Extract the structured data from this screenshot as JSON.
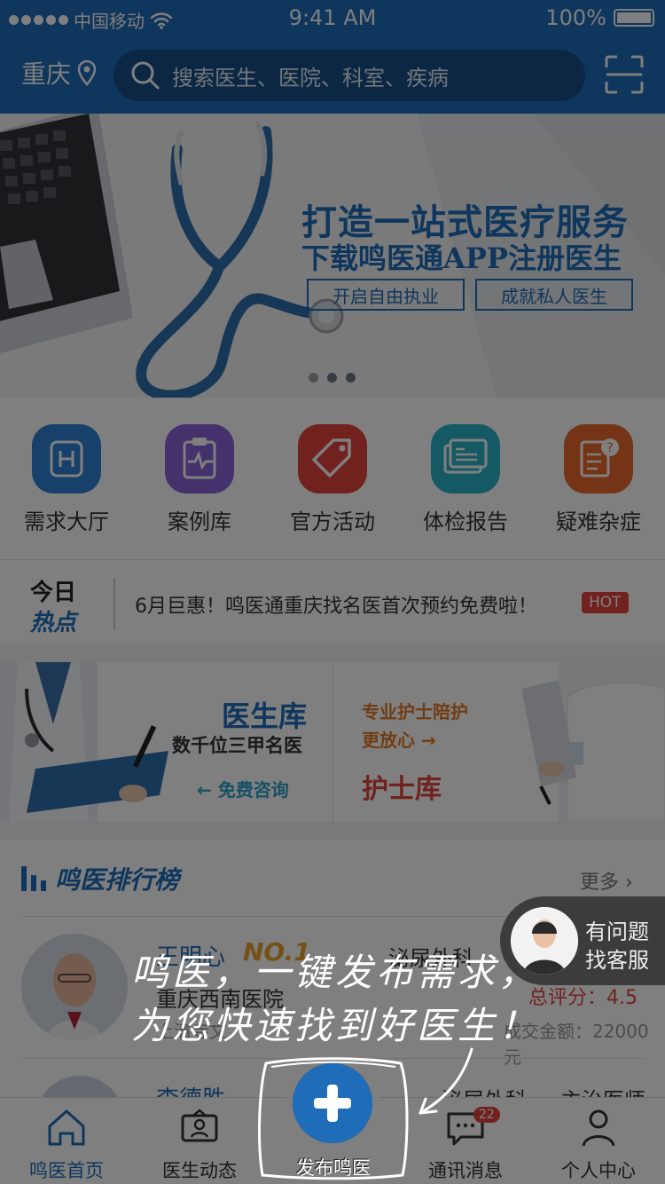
{
  "status_bar": {
    "carrier": "中国移动",
    "time": "9:41 AM",
    "battery": "100%"
  },
  "header": {
    "city": "重庆",
    "search_placeholder": "搜索医生、医院、科室、疾病"
  },
  "banner": {
    "title": "打造一站式医疗服务",
    "subtitle": "下载鸣医通APP注册医生",
    "buttons": [
      "开启自由执业",
      "成就私人医生"
    ]
  },
  "categories": [
    {
      "label": "需求大厅",
      "color": "#2f83d6"
    },
    {
      "label": "案例库",
      "color": "#8b63d9"
    },
    {
      "label": "官方活动",
      "color": "#e2433d"
    },
    {
      "label": "体检报告",
      "color": "#2bb3c8"
    },
    {
      "label": "疑难杂症",
      "color": "#e8692b"
    }
  ],
  "hot_news": {
    "logo_line1": "今日",
    "logo_line2": "热点",
    "text": "6月巨惠！鸣医通重庆找名医首次预约免费啦！",
    "badge": "HOT"
  },
  "doctor_lib": {
    "title": "医生库",
    "subtitle": "数千位三甲名医",
    "link": "← 免费咨询"
  },
  "nurse_lib": {
    "line1": "专业护士陪护",
    "line2": "更放心 →",
    "title": "护士库"
  },
  "ranking": {
    "title": "鸣医排行榜",
    "more": "更多",
    "rows": [
      {
        "name": "王明心",
        "badge": "NO.1",
        "dept": "泌尿外科",
        "hospital": "重庆西南医院",
        "score": "总评分：4.5",
        "address": "上清寺文",
        "deals": "成交金额：22000元"
      },
      {
        "name": "李德胜",
        "dept": "泌尿外科",
        "title": "主治医师"
      }
    ]
  },
  "customer_service": {
    "line1": "有问题",
    "line2": "找客服"
  },
  "guide": {
    "line1": "鸣医，一键发布需求，",
    "line2": "为您快速找到好医生！"
  },
  "tabs": [
    {
      "label": "鸣医首页",
      "active": true
    },
    {
      "label": "医生动态",
      "active": false
    },
    {
      "label": "发布鸣医",
      "active": false
    },
    {
      "label": "通讯消息",
      "active": false,
      "badge": "22"
    },
    {
      "label": "个人中心",
      "active": false
    }
  ]
}
